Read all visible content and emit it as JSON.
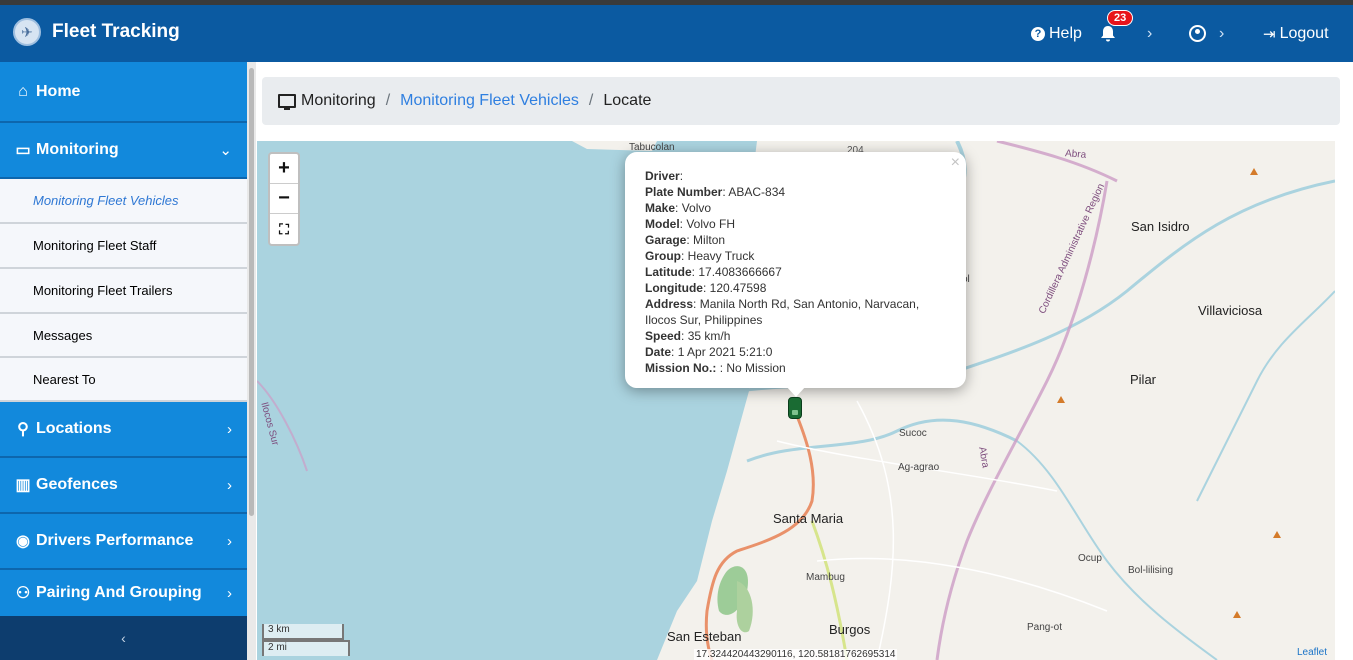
{
  "app": {
    "title": "Fleet Tracking"
  },
  "header": {
    "help_label": "Help",
    "notification_count": "23",
    "logout_label": "Logout"
  },
  "sidebar": {
    "items": [
      {
        "label": "Home",
        "icon": "home-icon"
      },
      {
        "label": "Monitoring",
        "icon": "monitor-icon",
        "expanded": true
      },
      {
        "label": "Locations",
        "icon": "map-marker-icon"
      },
      {
        "label": "Geofences",
        "icon": "map-icon"
      },
      {
        "label": "Drivers Performance",
        "icon": "driver-icon"
      },
      {
        "label": "Pairing And Grouping",
        "icon": "network-icon"
      }
    ],
    "sub_items": [
      {
        "label": "Monitoring Fleet Vehicles",
        "active": true
      },
      {
        "label": "Monitoring Fleet Staff"
      },
      {
        "label": "Monitoring Fleet Trailers"
      },
      {
        "label": "Messages"
      },
      {
        "label": "Nearest To"
      }
    ]
  },
  "breadcrumb": {
    "items": [
      "Monitoring",
      "Monitoring Fleet Vehicles",
      "Locate"
    ]
  },
  "map": {
    "popup": {
      "driver_label": "Driver",
      "driver_value": "",
      "plate_label": "Plate Number",
      "plate_value": "ABAC-834",
      "make_label": "Make",
      "make_value": "Volvo",
      "model_label": "Model",
      "model_value": "Volvo FH",
      "garage_label": "Garage",
      "garage_value": "Milton",
      "group_label": "Group",
      "group_value": "Heavy Truck",
      "latitude_label": "Latitude",
      "latitude_value": "17.4083666667",
      "longitude_label": "Longitude",
      "longitude_value": "120.47598",
      "address_label": "Address",
      "address_value": "Manila North Rd, San Antonio, Narvacan, Ilocos Sur, Philippines",
      "speed_label": "Speed",
      "speed_value": "35 km/h",
      "date_label": "Date",
      "date_value": "1 Apr 2021 5:21:0",
      "mission_label": "Mission No.:",
      "mission_value": ": No Mission"
    },
    "places": {
      "tabucolan": "Tabucolan",
      "san_isidro": "San Isidro",
      "villaviciosa": "Villaviciosa",
      "pilar": "Pilar",
      "sucoc": "Sucoc",
      "ag_agrao": "Ag-agrao",
      "santa_maria": "Santa Maria",
      "mambug": "Mambug",
      "ocup": "Ocup",
      "bol_lilising": "Bol-lilising",
      "san_esteban": "San Esteban",
      "burgos": "Burgos",
      "pang_ot": "Pang-ot",
      "abra_river": "Abra",
      "abra_road": "Abra",
      "ilocos_sur": "Ilocos Sur",
      "cordillera": "Cordillera Administrative Region",
      "road_label": "204",
      "partial_label": "ol"
    },
    "scale_km": "3 km",
    "scale_mi": "2 mi",
    "coords": "17.324420443290116, 120.58181762695314",
    "attribution": "Leaflet"
  },
  "colors": {
    "navbar": "#0b5aa1",
    "menu": "#1289dc",
    "water": "#aad3df",
    "link": "#2f7fe0"
  }
}
